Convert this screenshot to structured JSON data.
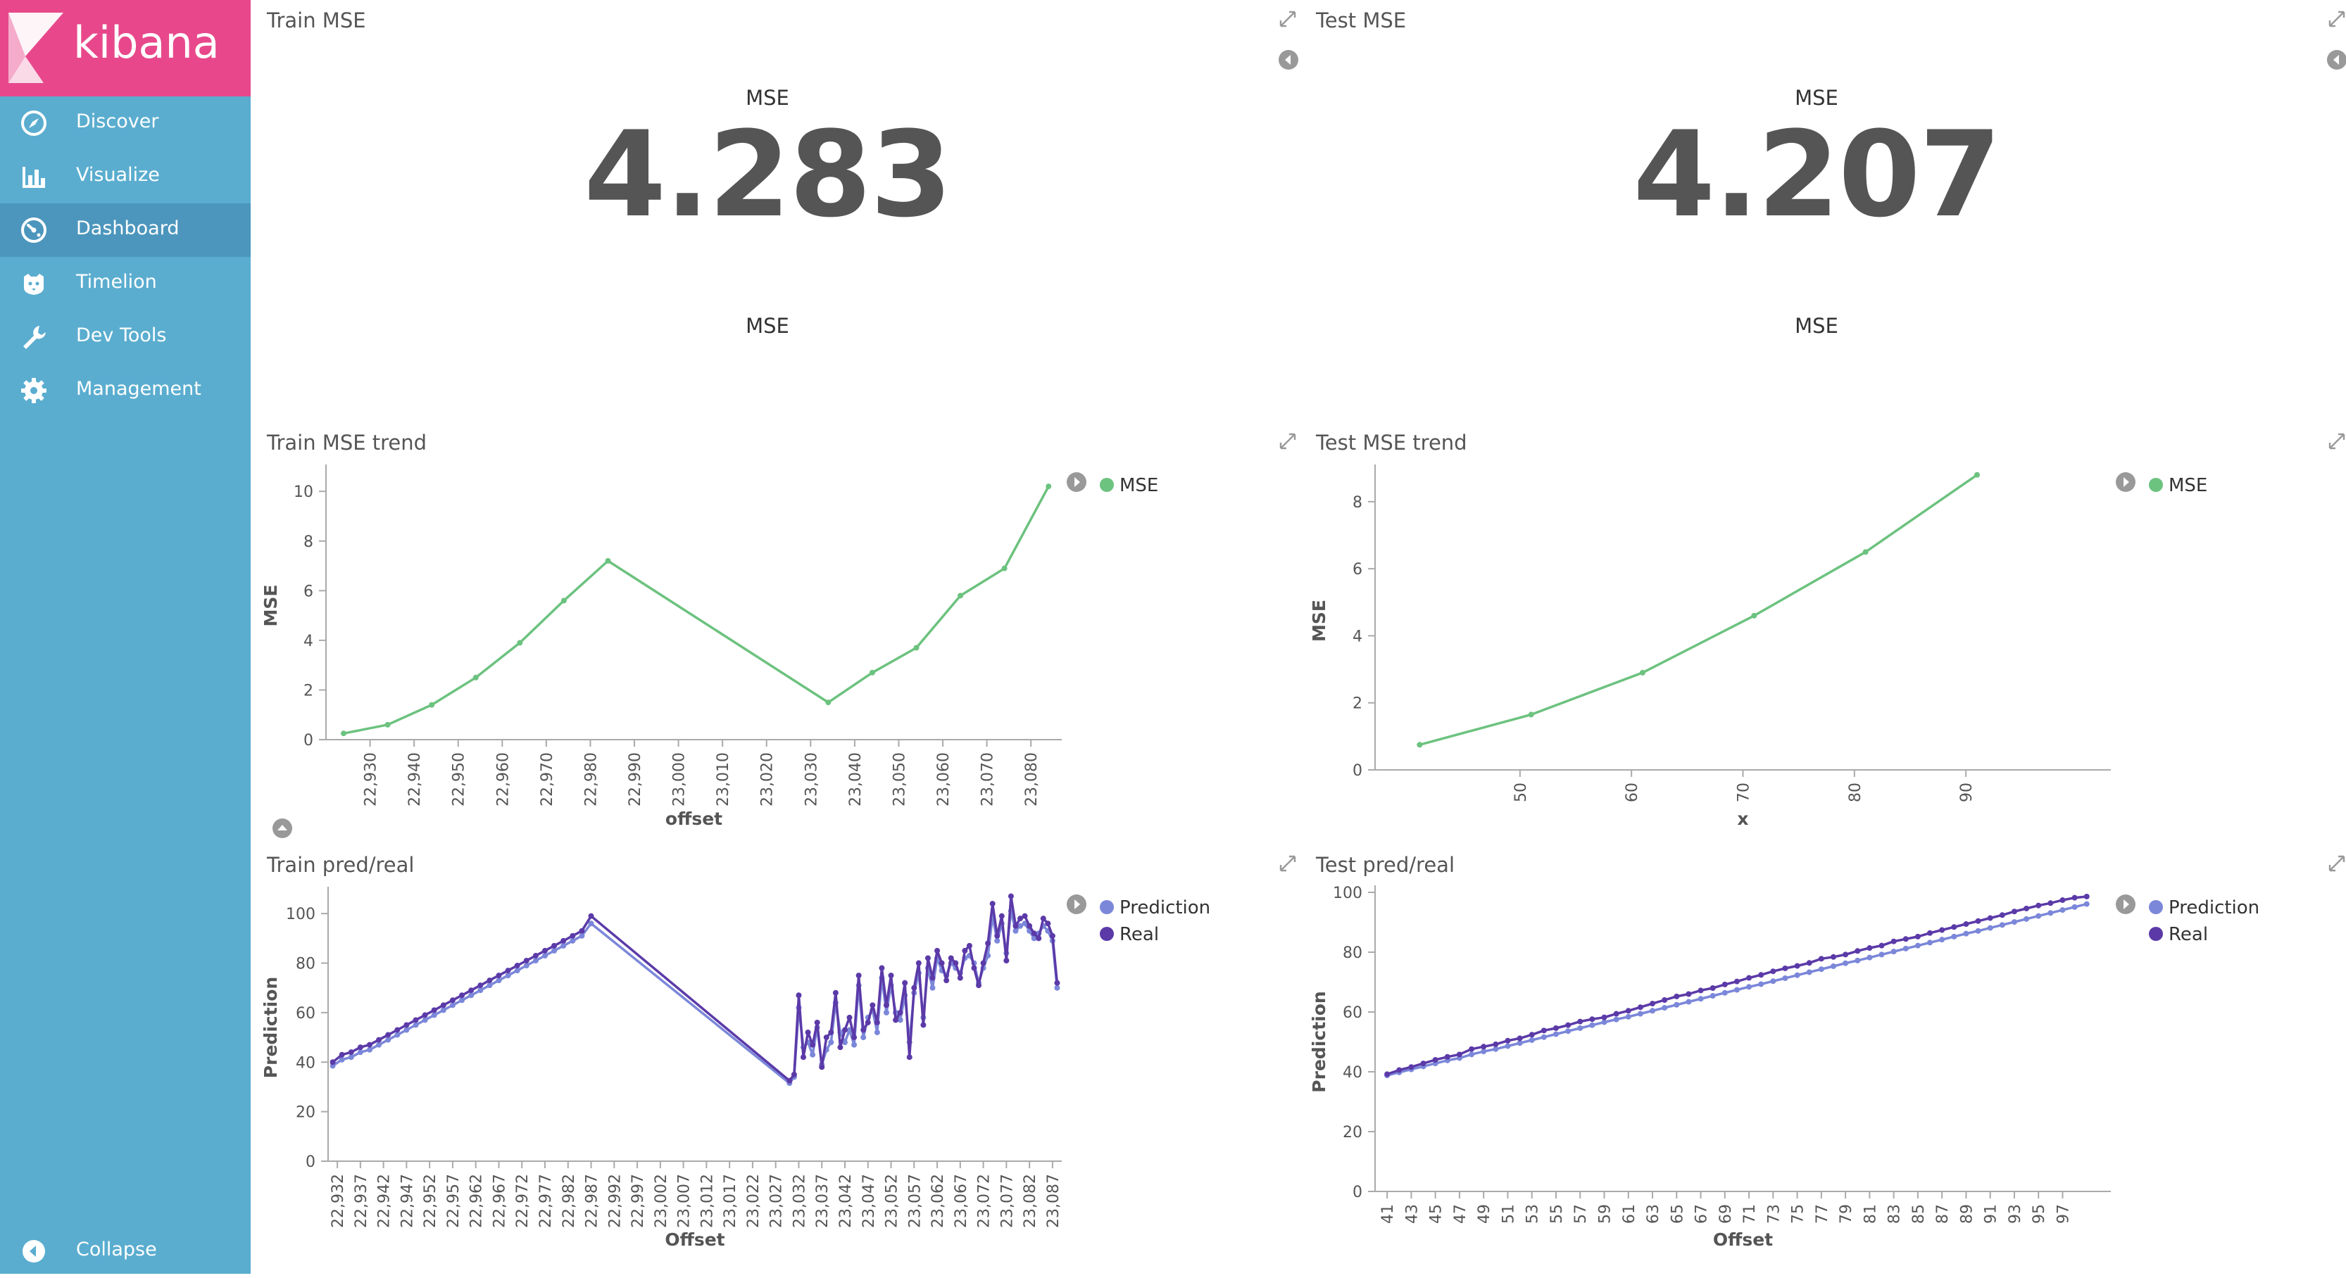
{
  "app": {
    "brand": "kibana"
  },
  "sidebar": {
    "items": [
      {
        "label": "Discover",
        "icon": "compass-icon"
      },
      {
        "label": "Visualize",
        "icon": "bar-chart-icon"
      },
      {
        "label": "Dashboard",
        "icon": "dashboard-gauge-icon",
        "active": true
      },
      {
        "label": "Timelion",
        "icon": "timelion-icon"
      },
      {
        "label": "Dev Tools",
        "icon": "wrench-icon"
      },
      {
        "label": "Management",
        "icon": "gear-icon"
      }
    ],
    "collapse_label": "Collapse"
  },
  "colors": {
    "brand": "#e8488b",
    "sidebar": "#5aadcf",
    "sidebar_active": "#4c96bd",
    "mse_series": "#6cc27f",
    "prediction_series": "#7b87d9",
    "real_series": "#5b3aa8"
  },
  "panels": {
    "train_mse": {
      "title": "Train MSE",
      "label_top": "MSE",
      "value": "4.283",
      "label_bottom": "MSE"
    },
    "test_mse": {
      "title": "Test MSE",
      "label_top": "MSE",
      "value": "4.207",
      "label_bottom": "MSE"
    },
    "train_trend": {
      "title": "Train MSE trend"
    },
    "test_trend": {
      "title": "Test MSE trend"
    },
    "train_pred": {
      "title": "Train pred/real"
    },
    "test_pred": {
      "title": "Test pred/real"
    }
  },
  "chart_data": [
    {
      "id": "train_trend",
      "type": "line",
      "title": "Train MSE trend",
      "xlabel": "offset",
      "ylabel": "MSE",
      "xlim": [
        22920,
        23087
      ],
      "ylim": [
        0,
        10.8
      ],
      "xticks": [
        22930,
        22940,
        22950,
        22960,
        22970,
        22980,
        22990,
        23000,
        23010,
        23020,
        23030,
        23040,
        23050,
        23060,
        23070,
        23080
      ],
      "yticks": [
        0,
        2,
        4,
        6,
        8,
        10
      ],
      "legend": "top-right",
      "grid": false,
      "series": [
        {
          "name": "MSE",
          "color": "#6cc27f",
          "x": [
            22924,
            22934,
            22944,
            22954,
            22964,
            22974,
            22984,
            23034,
            23044,
            23054,
            23064,
            23074,
            23084
          ],
          "y": [
            0.25,
            0.6,
            1.4,
            2.5,
            3.9,
            5.6,
            7.2,
            1.5,
            2.7,
            3.7,
            5.8,
            6.9,
            10.2
          ]
        }
      ]
    },
    {
      "id": "test_trend",
      "type": "line",
      "title": "Test MSE trend",
      "xlabel": "x",
      "ylabel": "MSE",
      "xlim": [
        37,
        103
      ],
      "ylim": [
        0,
        8.9
      ],
      "xticks": [
        50,
        60,
        70,
        80,
        90
      ],
      "yticks": [
        0,
        2,
        4,
        6,
        8
      ],
      "legend": "top-right",
      "grid": false,
      "series": [
        {
          "name": "MSE",
          "color": "#6cc27f",
          "x": [
            41,
            51,
            61,
            71,
            81,
            91
          ],
          "y": [
            0.75,
            1.65,
            2.9,
            4.6,
            6.5,
            8.8
          ]
        }
      ]
    },
    {
      "id": "train_pred",
      "type": "line",
      "title": "Train pred/real",
      "xlabel": "Offset",
      "ylabel": "Prediction",
      "xlim": [
        22930,
        23089
      ],
      "ylim": [
        0,
        108
      ],
      "xticks": [
        22932,
        22937,
        22942,
        22947,
        22952,
        22957,
        22962,
        22967,
        22972,
        22977,
        22982,
        22987,
        22992,
        22997,
        23002,
        23007,
        23012,
        23017,
        23022,
        23027,
        23032,
        23037,
        23042,
        23047,
        23052,
        23057,
        23062,
        23067,
        23072,
        23077,
        23082,
        23087
      ],
      "yticks": [
        0,
        20,
        40,
        60,
        80,
        100
      ],
      "legend": "top-right",
      "grid": false,
      "series": [
        {
          "name": "Prediction",
          "color": "#7b87d9",
          "x": [
            22931,
            22933,
            22935,
            22937,
            22939,
            22941,
            22943,
            22945,
            22947,
            22949,
            22951,
            22953,
            22955,
            22957,
            22959,
            22961,
            22963,
            22965,
            22967,
            22969,
            22971,
            22973,
            22975,
            22977,
            22979,
            22981,
            22983,
            22985,
            22987,
            23030,
            23031,
            23032,
            23033,
            23034,
            23035,
            23036,
            23037,
            23038,
            23039,
            23040,
            23041,
            23042,
            23043,
            23044,
            23045,
            23046,
            23047,
            23048,
            23049,
            23050,
            23051,
            23052,
            23053,
            23054,
            23055,
            23056,
            23057,
            23058,
            23059,
            23060,
            23061,
            23062,
            23063,
            23064,
            23065,
            23066,
            23067,
            23068,
            23069,
            23070,
            23071,
            23072,
            23073,
            23074,
            23075,
            23076,
            23077,
            23078,
            23079,
            23080,
            23081,
            23082,
            23083,
            23084,
            23085,
            23086,
            23087,
            23088
          ],
          "y": [
            38.5,
            41,
            42,
            44,
            45,
            47,
            49,
            51,
            53,
            55,
            57,
            59,
            61,
            63,
            65,
            67,
            69,
            71,
            73,
            75,
            77,
            79,
            81,
            83,
            85,
            87,
            89,
            91,
            96,
            31.5,
            34,
            62,
            46,
            48,
            43,
            54,
            39,
            45,
            48,
            64,
            52,
            48,
            53,
            47,
            71,
            50,
            58,
            61,
            52,
            74,
            60,
            71,
            60,
            57,
            67,
            48,
            68,
            76,
            58,
            78,
            70,
            82,
            77,
            75,
            80,
            78,
            76,
            82,
            83,
            80,
            72,
            78,
            83,
            99,
            89,
            96,
            84,
            101,
            93,
            95,
            96,
            93,
            90,
            92,
            95,
            93,
            89,
            70
          ]
        },
        {
          "name": "Real",
          "color": "#5b3aa8",
          "x": [
            22931,
            22933,
            22935,
            22937,
            22939,
            22941,
            22943,
            22945,
            22947,
            22949,
            22951,
            22953,
            22955,
            22957,
            22959,
            22961,
            22963,
            22965,
            22967,
            22969,
            22971,
            22973,
            22975,
            22977,
            22979,
            22981,
            22983,
            22985,
            22987,
            23030,
            23031,
            23032,
            23033,
            23034,
            23035,
            23036,
            23037,
            23038,
            23039,
            23040,
            23041,
            23042,
            23043,
            23044,
            23045,
            23046,
            23047,
            23048,
            23049,
            23050,
            23051,
            23052,
            23053,
            23054,
            23055,
            23056,
            23057,
            23058,
            23059,
            23060,
            23061,
            23062,
            23063,
            23064,
            23065,
            23066,
            23067,
            23068,
            23069,
            23070,
            23071,
            23072,
            23073,
            23074,
            23075,
            23076,
            23077,
            23078,
            23079,
            23080,
            23081,
            23082,
            23083,
            23084,
            23085,
            23086,
            23087,
            23088
          ],
          "y": [
            40,
            43,
            44,
            46,
            47,
            49,
            51,
            53,
            55,
            57,
            59,
            61,
            63,
            65,
            67,
            69,
            71,
            73,
            75,
            77,
            79,
            81,
            83,
            85,
            87,
            89,
            91,
            93,
            99,
            32.5,
            35,
            67,
            42,
            52,
            47,
            56,
            38,
            50,
            52,
            68,
            46,
            53,
            58,
            50,
            75,
            53,
            56,
            63,
            56,
            78,
            63,
            75,
            57,
            60,
            72,
            42,
            70,
            80,
            55,
            82,
            74,
            85,
            80,
            73,
            82,
            80,
            74,
            85,
            87,
            78,
            71,
            80,
            88,
            104,
            91,
            99,
            81,
            107,
            95,
            98,
            99,
            95,
            92,
            90,
            98,
            96,
            91,
            72
          ]
        }
      ]
    },
    {
      "id": "test_pred",
      "type": "line",
      "title": "Test pred/real",
      "xlabel": "Offset",
      "ylabel": "Prediction",
      "xlim": [
        40,
        101
      ],
      "ylim": [
        0,
        100
      ],
      "xticks": [
        41,
        43,
        45,
        47,
        49,
        51,
        53,
        55,
        57,
        59,
        61,
        63,
        65,
        67,
        69,
        71,
        73,
        75,
        77,
        79,
        81,
        83,
        85,
        87,
        89,
        91,
        93,
        95,
        97
      ],
      "yticks": [
        0,
        20,
        40,
        60,
        80,
        100
      ],
      "legend": "top-right",
      "grid": false,
      "series": [
        {
          "name": "Prediction",
          "color": "#7b87d9",
          "x": [
            41,
            42,
            43,
            44,
            45,
            46,
            47,
            48,
            49,
            50,
            51,
            52,
            53,
            54,
            55,
            56,
            57,
            58,
            59,
            60,
            61,
            62,
            63,
            64,
            65,
            66,
            67,
            68,
            69,
            70,
            71,
            72,
            73,
            74,
            75,
            76,
            77,
            78,
            79,
            80,
            81,
            82,
            83,
            84,
            85,
            86,
            87,
            88,
            89,
            90,
            91,
            92,
            93,
            94,
            95,
            96,
            97,
            98,
            99
          ],
          "y": [
            38.8,
            39.8,
            40.8,
            41.8,
            42.8,
            43.8,
            44.6,
            45.8,
            46.8,
            47.6,
            48.6,
            49.6,
            50.6,
            51.6,
            52.6,
            53.6,
            54.6,
            55.6,
            56.6,
            57.5,
            58.4,
            59.4,
            60.4,
            61.4,
            62.4,
            63.4,
            64.4,
            65.4,
            66.4,
            67.4,
            68.4,
            69.3,
            70.3,
            71.3,
            72.3,
            73.3,
            74.3,
            75.3,
            76.3,
            77.2,
            78.2,
            79.2,
            80.2,
            81.2,
            82.2,
            83.2,
            84.2,
            85.2,
            86.2,
            87.1,
            88.1,
            89.1,
            90.1,
            91.1,
            92.1,
            93.1,
            94.1,
            95.1,
            96.1
          ]
        },
        {
          "name": "Real",
          "color": "#5b3aa8",
          "x": [
            41,
            42,
            43,
            44,
            45,
            46,
            47,
            48,
            49,
            50,
            51,
            52,
            53,
            54,
            55,
            56,
            57,
            58,
            59,
            60,
            61,
            62,
            63,
            64,
            65,
            66,
            67,
            68,
            69,
            70,
            71,
            72,
            73,
            74,
            75,
            76,
            77,
            78,
            79,
            80,
            81,
            82,
            83,
            84,
            85,
            86,
            87,
            88,
            89,
            90,
            91,
            92,
            93,
            94,
            95,
            96,
            97,
            98,
            99
          ],
          "y": [
            39.2,
            40.6,
            41.6,
            42.8,
            44,
            45,
            45.8,
            47.6,
            48.4,
            49.2,
            50.4,
            51.2,
            52.4,
            53.8,
            54.6,
            55.6,
            56.8,
            57.6,
            58.2,
            59.4,
            60.4,
            61.6,
            62.8,
            64,
            65.2,
            66,
            67.2,
            68,
            69.2,
            70.2,
            71.4,
            72.4,
            73.6,
            74.6,
            75.4,
            76.4,
            77.8,
            78.4,
            79.2,
            80.4,
            81.4,
            82.2,
            83.6,
            84.4,
            85.2,
            86.4,
            87.4,
            88.4,
            89.4,
            90.4,
            91.4,
            92.4,
            93.6,
            94.6,
            95.6,
            96.4,
            97.4,
            98.2,
            98.6
          ]
        }
      ]
    }
  ]
}
